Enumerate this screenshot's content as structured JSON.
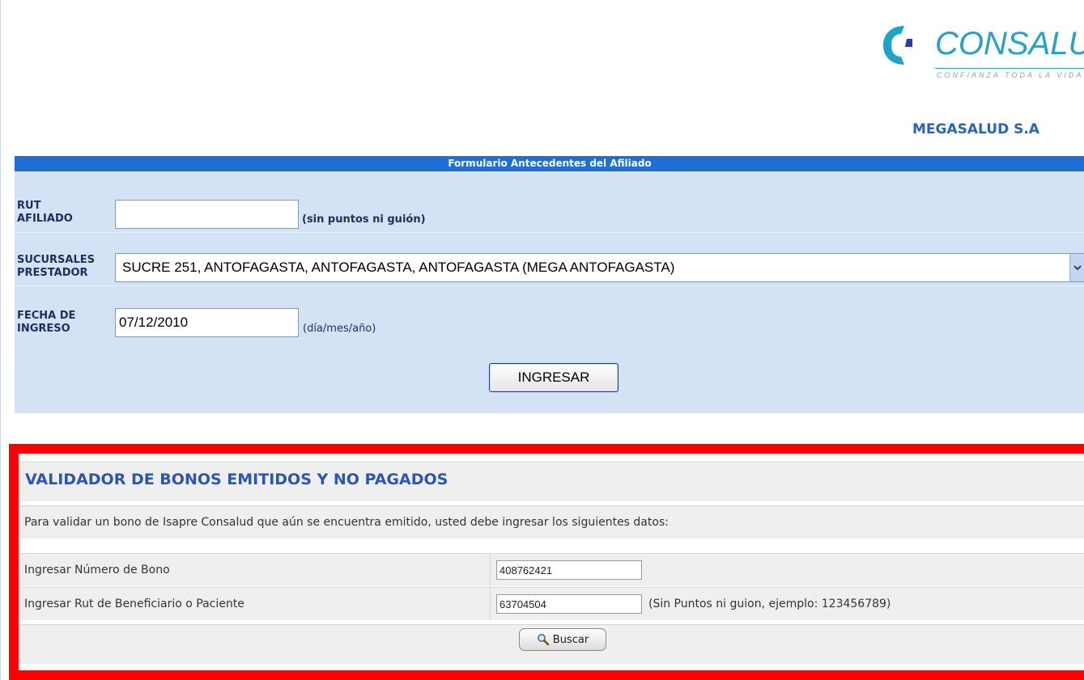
{
  "header": {
    "logo_word": "CONSALUD",
    "logo_tagline": "CONFIANZA TODA LA VIDA",
    "provider_name": "MEGASALUD S.A"
  },
  "form": {
    "title": "Formulario Antecedentes del Afiliado",
    "rut_label_line1": "RUT",
    "rut_label_line2": "AFILIADO",
    "rut_value": "",
    "rut_hint": "(sin puntos ni guión)",
    "branch_label_line1": "SUCURSALES",
    "branch_label_line2": "PRESTADOR",
    "branch_selected": "SUCRE 251, ANTOFAGASTA, ANTOFAGASTA, ANTOFAGASTA (MEGA ANTOFAGASTA)",
    "date_label_line1": "FECHA DE",
    "date_label_line2": "INGRESO",
    "date_value": "07/12/2010",
    "date_hint": "(día/mes/año)",
    "submit_label": "INGRESAR"
  },
  "validator": {
    "title": "VALIDADOR DE BONOS EMITIDOS Y NO PAGADOS",
    "instructions": "Para validar un bono de Isapre Consalud que aún se encuentra emitido, usted debe ingresar los siguientes datos:",
    "bono_label": "Ingresar Número de Bono",
    "bono_value": "408762421",
    "rut_label": "Ingresar Rut de Beneficiario o Paciente",
    "rut_value": "63704504",
    "rut_hint": "(Sin Puntos ni guion, ejemplo: 123456789)",
    "search_label": "Buscar"
  },
  "colors": {
    "form_header": "#1f6fd3",
    "form_background": "#d4e2f6",
    "validator_border": "#ff0000",
    "validator_title": "#2c56b5",
    "logo_accent": "#2d9fc2"
  }
}
